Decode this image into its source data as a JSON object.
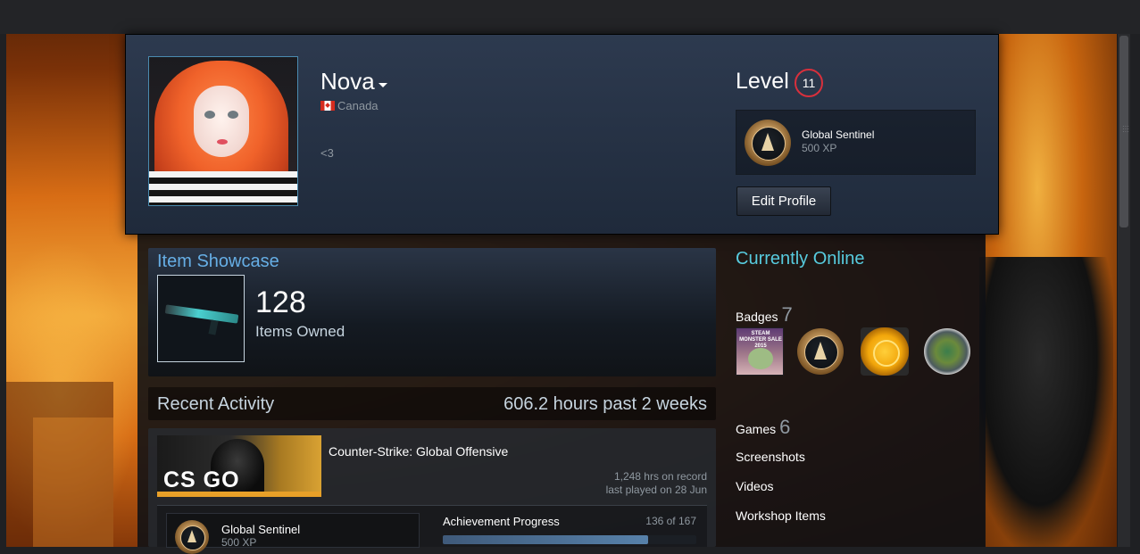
{
  "profile": {
    "persona_name": "Nova",
    "location": "Canada",
    "summary": "<3",
    "level_label": "Level",
    "level_value": "11",
    "favorite_badge": {
      "name": "Global Sentinel",
      "xp": "500 XP"
    },
    "edit_profile_label": "Edit Profile"
  },
  "showcase": {
    "title": "Item Showcase",
    "count": "128",
    "count_label": "Items Owned"
  },
  "recent_activity": {
    "title": "Recent Activity",
    "hours_summary": "606.2 hours past 2 weeks",
    "game": {
      "name": "Counter-Strike: Global Offensive",
      "capsule_text": "CS GO",
      "hours_on_record": "1,248 hrs on record",
      "last_played": "last played on 28 Jun",
      "badge": {
        "name": "Global Sentinel",
        "xp": "500 XP"
      },
      "achievement_label": "Achievement Progress",
      "achievement_count": "136 of 167",
      "achievement_progress": 0.81
    }
  },
  "sidebar": {
    "status": "Currently Online",
    "badges_label": "Badges",
    "badges_count": "7",
    "badge_steam_text": "STEAM MONSTER SALE 2015",
    "games_label": "Games",
    "games_count": "6",
    "links": [
      "Screenshots",
      "Videos",
      "Workshop Items"
    ]
  },
  "colors": {
    "status_online": "#57cbde",
    "showcase_title": "#66aee5",
    "level_ring": "#d8303c"
  }
}
